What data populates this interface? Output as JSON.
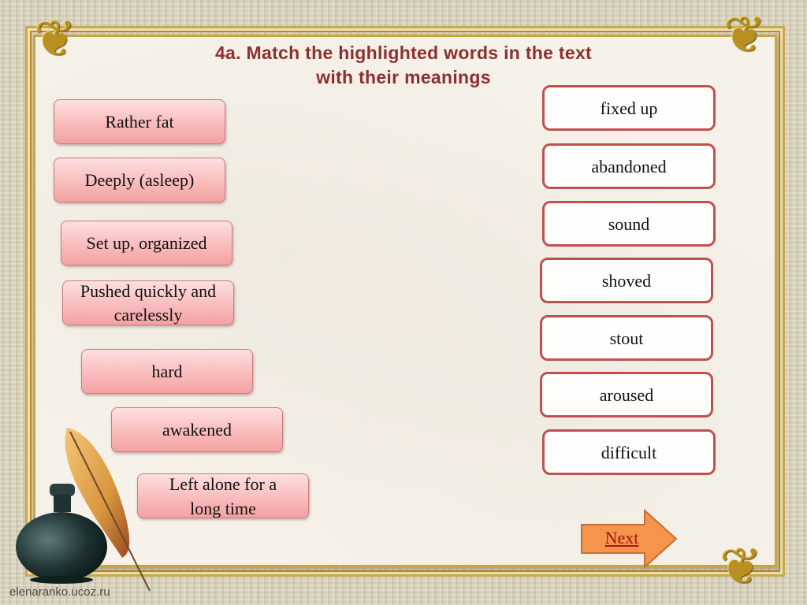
{
  "title": {
    "line1": "4a. Match the highlighted words in the text",
    "line2": "with their meanings"
  },
  "meanings": [
    {
      "label": "Rather fat"
    },
    {
      "label": "Deeply (asleep)"
    },
    {
      "label": "Set up, organized"
    },
    {
      "label": "Pushed quickly and carelessly"
    },
    {
      "label": "hard"
    },
    {
      "label": "awakened"
    },
    {
      "label": "Left alone for a long time"
    }
  ],
  "words": [
    {
      "label": "fixed up"
    },
    {
      "label": "abandoned"
    },
    {
      "label": "sound"
    },
    {
      "label": "shoved"
    },
    {
      "label": "stout"
    },
    {
      "label": "aroused"
    },
    {
      "label": "difficult"
    }
  ],
  "next_button": {
    "label": "Next",
    "icon": "arrow-right-icon"
  },
  "footer": {
    "site": "elenaranko.ucoz.ru"
  },
  "decorations": {
    "corner": "ornament-icon",
    "inkwell": "inkwell-icon",
    "quill": "quill-icon"
  },
  "colors": {
    "title": "#8e2f2f",
    "left_card": "#f9bcbc",
    "right_border": "#c05050",
    "next_fill": "#f7934a",
    "next_text": "#a01818",
    "frame_gold": "#caa53e"
  }
}
